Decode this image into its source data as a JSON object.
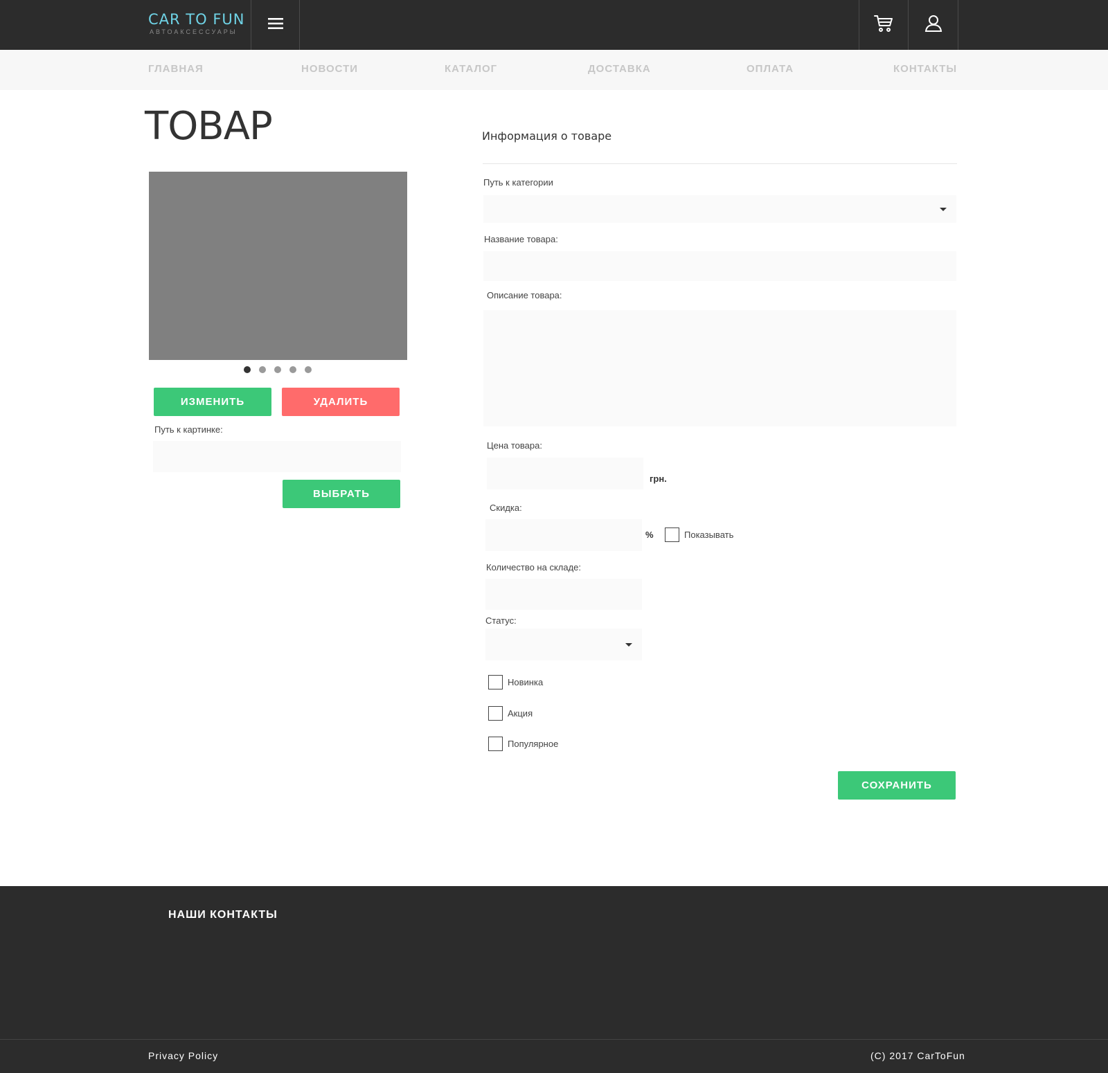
{
  "header": {
    "logo_title": "CAR TO FUN",
    "logo_subtitle": "АВТОАКСЕССУАРЫ",
    "menu_icon": "hamburger-menu-icon",
    "cart_icon": "shopping-cart-icon",
    "user_icon": "user-icon"
  },
  "nav": {
    "items": [
      "ГЛАВНАЯ",
      "НОВОСТИ",
      "КАТАЛОГ",
      "ДОСТАВКА",
      "ОПЛАТА",
      "КОНТАКТЫ"
    ]
  },
  "page": {
    "title": "ТОВАР"
  },
  "gallery": {
    "dots_total": 5,
    "active_dot": 1,
    "edit_label": "ИЗМЕНИТЬ",
    "delete_label": "УДАЛИТЬ",
    "image_path_label": "Путь к картинке:",
    "image_path_value": "",
    "choose_label": "ВЫБРАТЬ"
  },
  "form": {
    "section_title": "Информация о товаре",
    "category_label": "Путь к категории",
    "category_value": "",
    "name_label": "Название товара:",
    "name_value": "",
    "description_label": "Описание товара:",
    "description_value": "",
    "price_label": "Цена товара:",
    "price_value": "",
    "price_unit": "грн.",
    "discount_label": "Скидка:",
    "discount_value": "",
    "discount_unit": "%",
    "show_label": "Показывать",
    "stock_label": "Количество на складе:",
    "stock_value": "",
    "status_label": "Статус:",
    "status_value": "",
    "new_label": "Новинка",
    "promo_label": "Акция",
    "popular_label": "Популярное",
    "save_label": "СОХРАНИТЬ"
  },
  "colors": {
    "accent_green": "#3cc878",
    "accent_red": "#ff6b6b",
    "dark_bg": "#2c2c2c",
    "logo_cyan": "#6fd3e6"
  },
  "footer": {
    "title": "НАШИ КОНТАКТЫ",
    "privacy": "Privacy Policy",
    "copyright": "(C) 2017 CarToFun"
  }
}
